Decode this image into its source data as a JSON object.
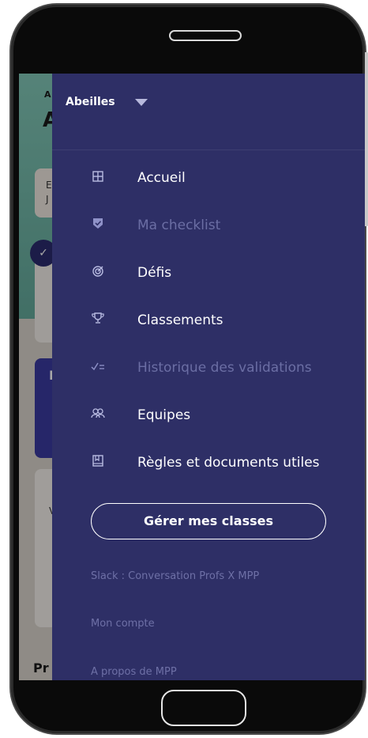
{
  "header": {
    "hive_name": "Abeilles"
  },
  "menu": {
    "items": [
      {
        "label": "Accueil",
        "icon": "grid-icon",
        "enabled": true
      },
      {
        "label": "Ma checklist",
        "icon": "shield-check-icon",
        "enabled": false
      },
      {
        "label": "Défis",
        "icon": "target-icon",
        "enabled": true
      },
      {
        "label": "Classements",
        "icon": "trophy-icon",
        "enabled": true
      },
      {
        "label": "Historique des validations",
        "icon": "check-list-icon",
        "enabled": false
      },
      {
        "label": "Equipes",
        "icon": "team-icon",
        "enabled": true
      },
      {
        "label": "Règles et documents utiles",
        "icon": "book-icon",
        "enabled": true
      }
    ]
  },
  "manage_button": {
    "label": "Gérer mes classes"
  },
  "footer": {
    "links": [
      "Slack : Conversation Profs X MPP",
      "Mon compte",
      "A propos de MPP"
    ]
  },
  "background_app": {
    "letters": [
      "A",
      "A",
      "E",
      "J",
      "No",
      "V",
      "Pr"
    ]
  },
  "colors": {
    "drawer_bg": "#2e2f66",
    "text_primary": "#ffffff",
    "text_muted": "#6b6ea4",
    "icon": "#b9bce2"
  }
}
